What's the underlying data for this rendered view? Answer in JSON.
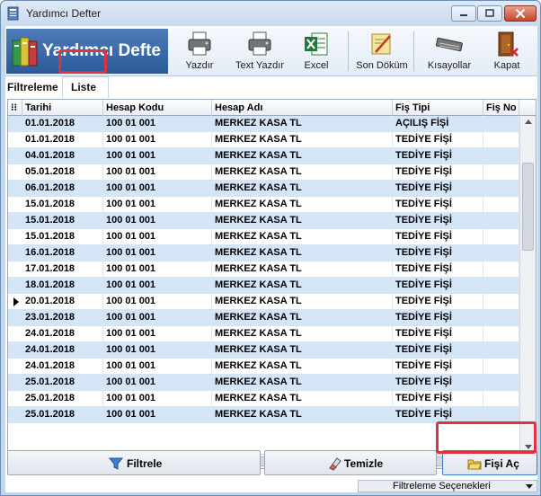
{
  "window": {
    "title": "Yardımcı Defter"
  },
  "banner": {
    "title": "Yardımcı Defte"
  },
  "toolbar": {
    "print_label": "Yazdır",
    "text_print_label": "Text Yazdır",
    "excel_label": "Excel",
    "dump_label": "Son Döküm",
    "shortcuts_label": "Kısayollar",
    "close_label": "Kapat"
  },
  "tabs": {
    "filter_label": "Filtreleme",
    "list_label": "Liste"
  },
  "grid": {
    "columns": [
      "Tarihi",
      "Hesap Kodu",
      "Hesap Adı",
      "Fiş Tipi",
      "Fiş No"
    ],
    "rows": [
      {
        "date": "01.01.2018",
        "code": "100 01 001",
        "name": "MERKEZ KASA TL",
        "type": "AÇILIŞ FİŞİ"
      },
      {
        "date": "01.01.2018",
        "code": "100 01 001",
        "name": "MERKEZ KASA TL",
        "type": "TEDİYE FİŞİ"
      },
      {
        "date": "04.01.2018",
        "code": "100 01 001",
        "name": "MERKEZ KASA TL",
        "type": "TEDİYE FİŞİ"
      },
      {
        "date": "05.01.2018",
        "code": "100 01 001",
        "name": "MERKEZ KASA TL",
        "type": "TEDİYE FİŞİ"
      },
      {
        "date": "06.01.2018",
        "code": "100 01 001",
        "name": "MERKEZ KASA TL",
        "type": "TEDİYE FİŞİ"
      },
      {
        "date": "15.01.2018",
        "code": "100 01 001",
        "name": "MERKEZ KASA TL",
        "type": "TEDİYE FİŞİ"
      },
      {
        "date": "15.01.2018",
        "code": "100 01 001",
        "name": "MERKEZ KASA TL",
        "type": "TEDİYE FİŞİ"
      },
      {
        "date": "15.01.2018",
        "code": "100 01 001",
        "name": "MERKEZ KASA TL",
        "type": "TEDİYE FİŞİ"
      },
      {
        "date": "16.01.2018",
        "code": "100 01 001",
        "name": "MERKEZ KASA TL",
        "type": "TEDİYE FİŞİ"
      },
      {
        "date": "17.01.2018",
        "code": "100 01 001",
        "name": "MERKEZ KASA TL",
        "type": "TEDİYE FİŞİ"
      },
      {
        "date": "18.01.2018",
        "code": "100 01 001",
        "name": "MERKEZ KASA TL",
        "type": "TEDİYE FİŞİ"
      },
      {
        "date": "20.01.2018",
        "code": "100 01 001",
        "name": "MERKEZ KASA TL",
        "type": "TEDİYE FİŞİ",
        "current": true
      },
      {
        "date": "23.01.2018",
        "code": "100 01 001",
        "name": "MERKEZ KASA TL",
        "type": "TEDİYE FİŞİ"
      },
      {
        "date": "24.01.2018",
        "code": "100 01 001",
        "name": "MERKEZ KASA TL",
        "type": "TEDİYE FİŞİ"
      },
      {
        "date": "24.01.2018",
        "code": "100 01 001",
        "name": "MERKEZ KASA TL",
        "type": "TEDİYE FİŞİ"
      },
      {
        "date": "24.01.2018",
        "code": "100 01 001",
        "name": "MERKEZ KASA TL",
        "type": "TEDİYE FİŞİ"
      },
      {
        "date": "25.01.2018",
        "code": "100 01 001",
        "name": "MERKEZ KASA TL",
        "type": "TEDİYE FİŞİ"
      },
      {
        "date": "25.01.2018",
        "code": "100 01 001",
        "name": "MERKEZ KASA TL",
        "type": "TEDİYE FİŞİ"
      },
      {
        "date": "25.01.2018",
        "code": "100 01 001",
        "name": "MERKEZ KASA TL",
        "type": "TEDİYE FİŞİ"
      }
    ]
  },
  "buttons": {
    "filter_label": "Filtrele",
    "clear_label": "Temizle",
    "open_label": "Fişi Aç"
  },
  "filter_options": {
    "label": "Filtreleme Seçenekleri"
  },
  "colors": {
    "alt_row": "#d4e5f7",
    "highlight": "#e0333c",
    "banner": "#2b5a9a"
  },
  "icons": {
    "print": "printer-icon",
    "text_print": "printer-icon",
    "excel": "excel-icon",
    "dump": "note-icon",
    "shortcuts": "keyboard-icon",
    "close": "exit-door-icon",
    "filter": "funnel-icon",
    "clear": "eraser-icon",
    "open": "folder-icon"
  }
}
